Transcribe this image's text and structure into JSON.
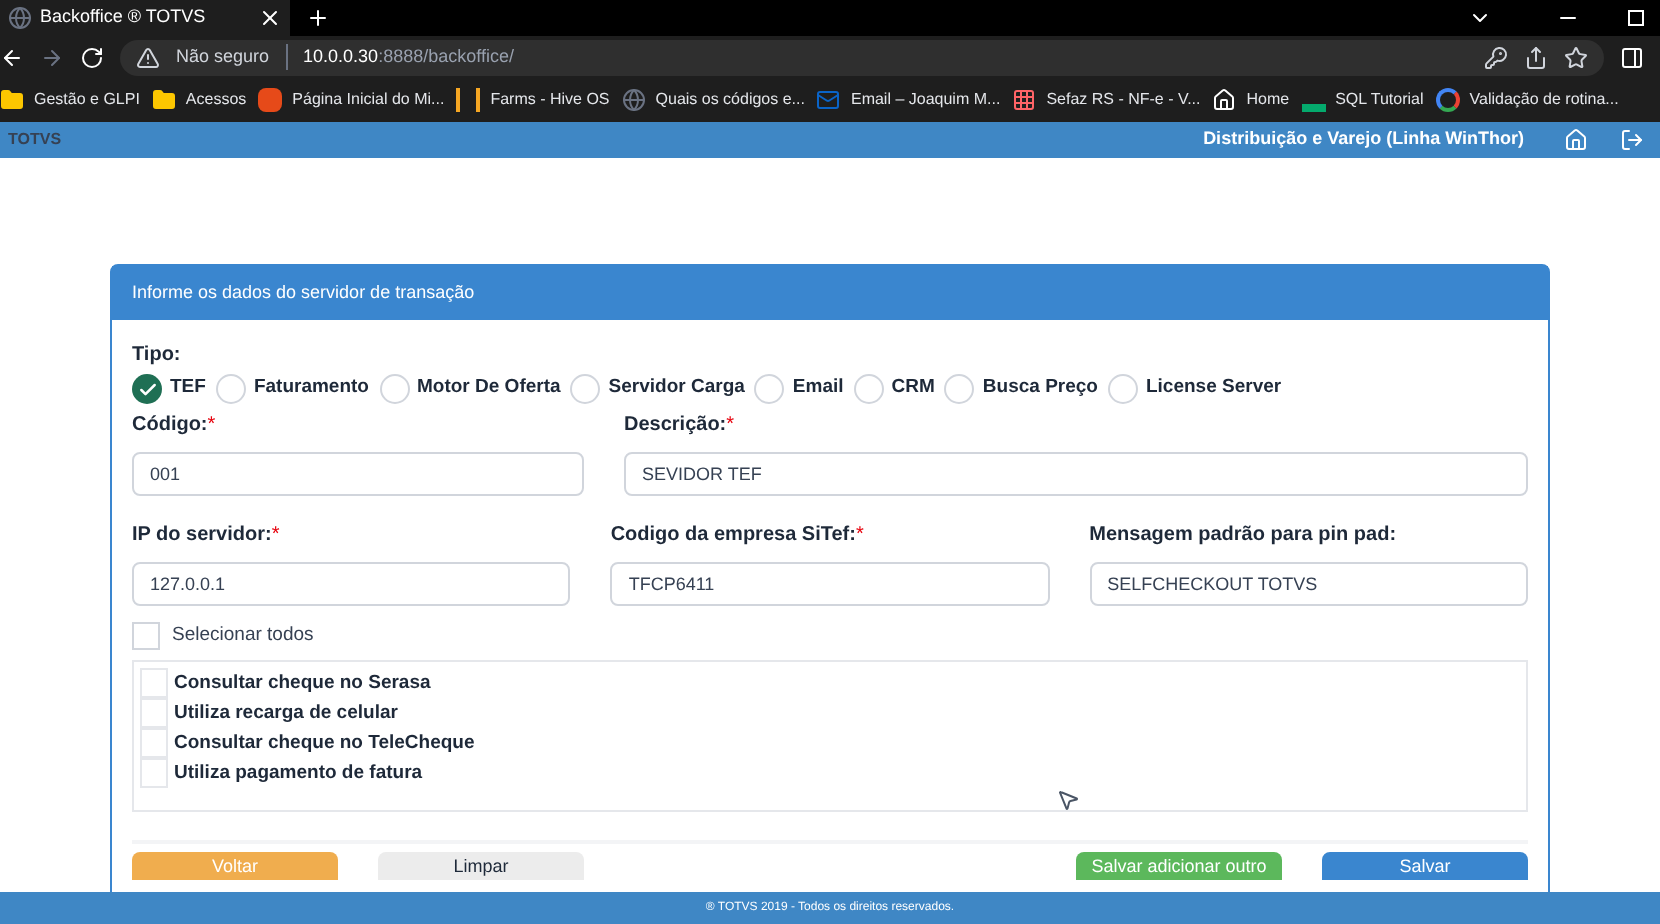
{
  "browser": {
    "tab_title": "Backoffice ® TOTVS",
    "security": "Não seguro",
    "url_host": "10.0.0.30",
    "url_rest": ":8888/backoffice/",
    "bookmarks": [
      {
        "label": "Gestão e GLPI",
        "kind": "folder"
      },
      {
        "label": "Acessos",
        "kind": "folder"
      },
      {
        "label": "Página Inicial do Mi...",
        "kind": "office"
      },
      {
        "label": "Farms - Hive OS",
        "kind": "hive"
      },
      {
        "label": "Quais os códigos e...",
        "kind": "globe"
      },
      {
        "label": "Email – Joaquim M...",
        "kind": "mail"
      },
      {
        "label": "Sefaz RS - NF-e - V...",
        "kind": "grid"
      },
      {
        "label": "Home",
        "kind": "home"
      },
      {
        "label": "SQL Tutorial",
        "kind": "w"
      },
      {
        "label": "Validação de rotina...",
        "kind": "google"
      }
    ]
  },
  "app_header": {
    "logo": "TOTVS",
    "context": "Distribuição e Varejo (Linha WinThor)"
  },
  "panel": {
    "title": "Informe os dados do servidor de transação",
    "tipo_label": "Tipo:",
    "tipos": [
      {
        "label": "TEF",
        "selected": true
      },
      {
        "label": "Faturamento",
        "selected": false
      },
      {
        "label": "Motor De Oferta",
        "selected": false
      },
      {
        "label": "Servidor Carga",
        "selected": false
      },
      {
        "label": "Email",
        "selected": false
      },
      {
        "label": "CRM",
        "selected": false
      },
      {
        "label": "Busca Preço",
        "selected": false
      },
      {
        "label": "License Server",
        "selected": false
      }
    ],
    "fields": [
      {
        "label": "Código:",
        "required_mark": "*",
        "value": "001"
      },
      {
        "label": "Descrição:",
        "required_mark": "*",
        "value": "SEVIDOR TEF"
      },
      {
        "label": "IP do servidor:",
        "required_mark": "*",
        "value": "127.0.0.1"
      },
      {
        "label": "Codigo da empresa SiTef:",
        "required_mark": "*",
        "value": "TFCP6411"
      },
      {
        "label": "Mensagem padrão para pin pad:",
        "value": "SELFCHECKOUT TOTVS"
      }
    ],
    "select_all": {
      "label": "Selecionar todos",
      "checked": false
    },
    "options": [
      {
        "label": "Consultar cheque no Serasa",
        "checked": false
      },
      {
        "label": "Utiliza recarga de celular",
        "checked": false
      },
      {
        "label": "Consultar cheque no TeleCheque",
        "checked": false
      },
      {
        "label": "Utiliza pagamento de fatura",
        "checked": false
      }
    ],
    "buttons": [
      {
        "label": "Voltar",
        "kind": "warning"
      },
      {
        "label": "Limpar",
        "kind": "default"
      },
      {
        "label": "Salvar adicionar outro",
        "kind": "success"
      },
      {
        "label": "Salvar",
        "kind": "primary"
      }
    ]
  },
  "footer": "® TOTVS 2019 - Todos os direitos reservados."
}
